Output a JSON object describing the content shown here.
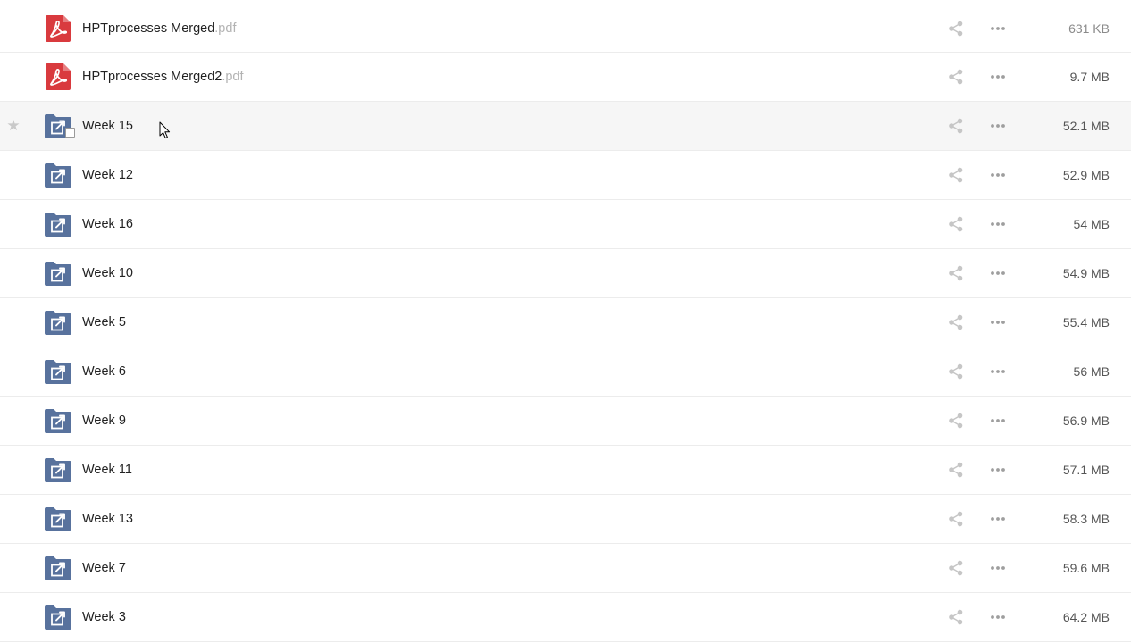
{
  "files": [
    {
      "name": "HPTprocesses Merged",
      "ext": ".pdf",
      "size": "631 KB",
      "type": "pdf"
    },
    {
      "name": "HPTprocesses Merged2",
      "ext": ".pdf",
      "size": "9.7 MB",
      "type": "pdf"
    },
    {
      "name": "Week 15",
      "ext": "",
      "size": "52.1 MB",
      "type": "shared-folder"
    },
    {
      "name": "Week 12",
      "ext": "",
      "size": "52.9 MB",
      "type": "shared-folder"
    },
    {
      "name": "Week 16",
      "ext": "",
      "size": "54 MB",
      "type": "shared-folder"
    },
    {
      "name": "Week 10",
      "ext": "",
      "size": "54.9 MB",
      "type": "shared-folder"
    },
    {
      "name": "Week 5",
      "ext": "",
      "size": "55.4 MB",
      "type": "shared-folder"
    },
    {
      "name": "Week 6",
      "ext": "",
      "size": "56 MB",
      "type": "shared-folder"
    },
    {
      "name": "Week 9",
      "ext": "",
      "size": "56.9 MB",
      "type": "shared-folder"
    },
    {
      "name": "Week 11",
      "ext": "",
      "size": "57.1 MB",
      "type": "shared-folder"
    },
    {
      "name": "Week 13",
      "ext": "",
      "size": "58.3 MB",
      "type": "shared-folder"
    },
    {
      "name": "Week 7",
      "ext": "",
      "size": "59.6 MB",
      "type": "shared-folder"
    },
    {
      "name": "Week 3",
      "ext": "",
      "size": "64.2 MB",
      "type": "shared-folder"
    }
  ],
  "hovered_file": "Week 15",
  "colors": {
    "pdf_red": "#d93a3e",
    "folder_blue": "#58729d",
    "action_gray": "#c6c6c6",
    "row_border": "#ececec",
    "hover_bg": "#f6f6f6"
  }
}
